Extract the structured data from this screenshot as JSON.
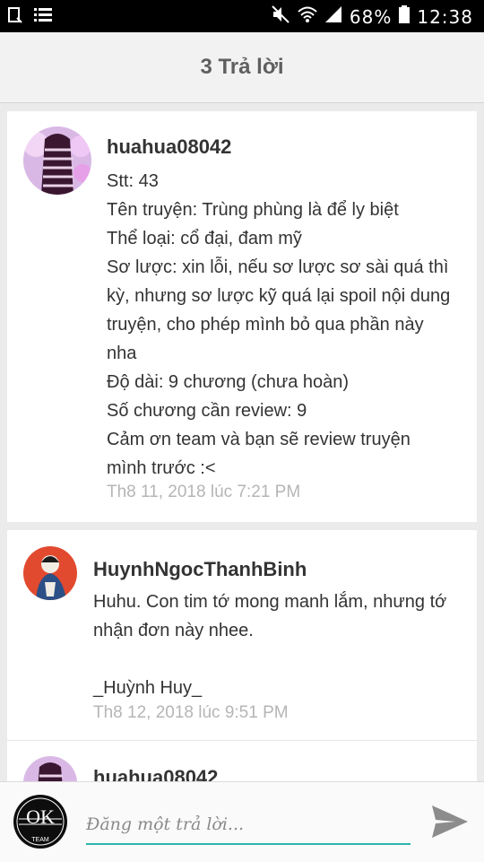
{
  "status_bar": {
    "battery_percent": "68%",
    "time": "12:38",
    "icons": [
      "screenshot-icon",
      "list-icon",
      "mute-icon",
      "wifi-icon",
      "signal-icon",
      "battery-icon"
    ]
  },
  "header": {
    "title": "3 Trả lời"
  },
  "replies": [
    {
      "author": "huahua08042",
      "lines": [
        "Stt: 43",
        "Tên truyện: Trùng phùng là để ly biệt",
        "Thể loại: cổ đại, đam mỹ",
        "Sơ lược: xin lỗi, nếu sơ lược sơ sài quá thì",
        "kỳ, nhưng sơ lược kỹ quá lại spoil nội dung",
        "truyện, cho phép mình bỏ qua phần này",
        "nha",
        "Độ dài: 9 chương (chưa hoàn)",
        "Số chương cần review: 9",
        "Cảm ơn team và bạn sẽ review truyện",
        "mình trước :<"
      ],
      "timestamp": "Th8 11, 2018 lúc 7:21 PM"
    },
    {
      "author": "HuynhNgocThanhBinh",
      "lines": [
        "Huhu. Con tim tớ mong manh lắm, nhưng tớ",
        "nhận đơn này nhee.",
        "",
        "_Huỳnh Huy_"
      ],
      "timestamp": "Th8 12, 2018 lúc 9:51 PM"
    },
    {
      "author": "huahua08042"
    }
  ],
  "reply_bar": {
    "placeholder": "Đăng một trả lời...",
    "logo_text": "OK",
    "logo_subtext": "TEAM",
    "accent_color": "#2bb5ad"
  }
}
